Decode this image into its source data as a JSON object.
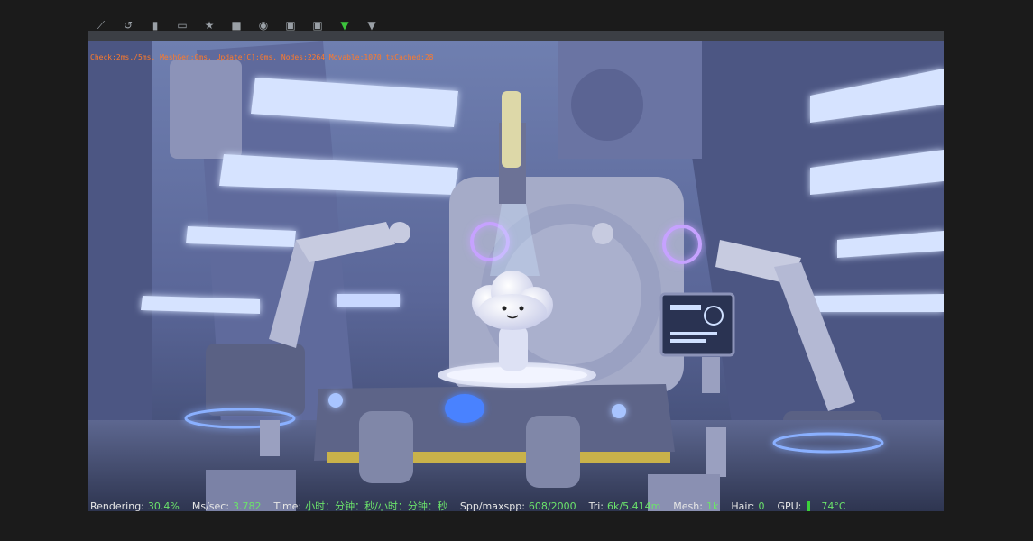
{
  "toolbar": {
    "buttons": [
      {
        "name": "brush-icon",
        "glyph": "⟋"
      },
      {
        "name": "undo-icon",
        "glyph": "↺"
      },
      {
        "name": "save-icon",
        "glyph": "▮"
      },
      {
        "name": "folder-icon",
        "glyph": "▭"
      },
      {
        "name": "star-icon",
        "glyph": "★"
      },
      {
        "name": "cube-icon",
        "glyph": "■"
      },
      {
        "name": "globe-icon",
        "glyph": "◉"
      },
      {
        "name": "image-icon",
        "glyph": "▣"
      },
      {
        "name": "camera-icon",
        "glyph": "▣"
      },
      {
        "name": "play-icon",
        "glyph": "▼"
      },
      {
        "name": "filter-icon",
        "glyph": "▼"
      }
    ]
  },
  "viewport": {
    "stats_line": "Check:2ms./5ms. MeshGen:0ms. Update[C]:0ms. Nodes:2264 Movable:1070 txCached:28"
  },
  "status": {
    "rendering_label": "Rendering:",
    "rendering_value": "30.4%",
    "ms_label": "Ms/sec:",
    "ms_value": "3.782",
    "time_label": "Time:",
    "time_value": "小时：分钟：秒/小时：分钟：秒",
    "spp_label": "Spp/maxspp:",
    "spp_value": "608/2000",
    "tri_label": "Tri:",
    "tri_value": "6k/5.414m",
    "mesh_label": "Mesh:",
    "mesh_value": "1k",
    "hair_label": "Hair:",
    "hair_value": "0",
    "gpu_label": "GPU:",
    "gpu_value": "74°C"
  },
  "colors": {
    "accent_green": "#6be36b",
    "stats_orange": "#ff7a2a",
    "neon_blue": "#9fc0ff"
  }
}
